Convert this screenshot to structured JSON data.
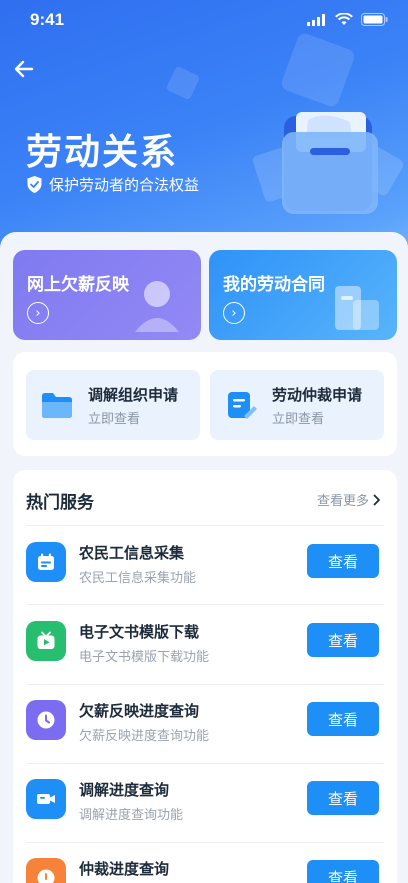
{
  "status": {
    "time": "9:41"
  },
  "header": {
    "title": "劳动关系",
    "subtitle": "保护劳动者的合法权益"
  },
  "cards": [
    {
      "label": "网上欠薪反映"
    },
    {
      "label": "我的劳动合同"
    }
  ],
  "applications": [
    {
      "title": "调解组织申请",
      "sub": "立即查看"
    },
    {
      "title": "劳动仲裁申请",
      "sub": "立即查看"
    }
  ],
  "services": {
    "header": "热门服务",
    "more": "查看更多",
    "button_label": "查看",
    "items": [
      {
        "name": "农民工信息采集",
        "desc": "农民工信息采集功能",
        "color": "#1e8ff7",
        "icon": "calendar-icon"
      },
      {
        "name": "电子文书模版下载",
        "desc": "电子文书模版下载功能",
        "color": "#27be6f",
        "icon": "tv-play-icon"
      },
      {
        "name": "欠薪反映进度查询",
        "desc": "欠薪反映进度查询功能",
        "color": "#7b6cf2",
        "icon": "clock-icon"
      },
      {
        "name": "调解进度查询",
        "desc": "调解进度查询功能",
        "color": "#1e8ff7",
        "icon": "video-icon"
      },
      {
        "name": "仲裁进度查询",
        "desc": "",
        "color": "#f7833a",
        "icon": "alert-icon"
      }
    ]
  }
}
